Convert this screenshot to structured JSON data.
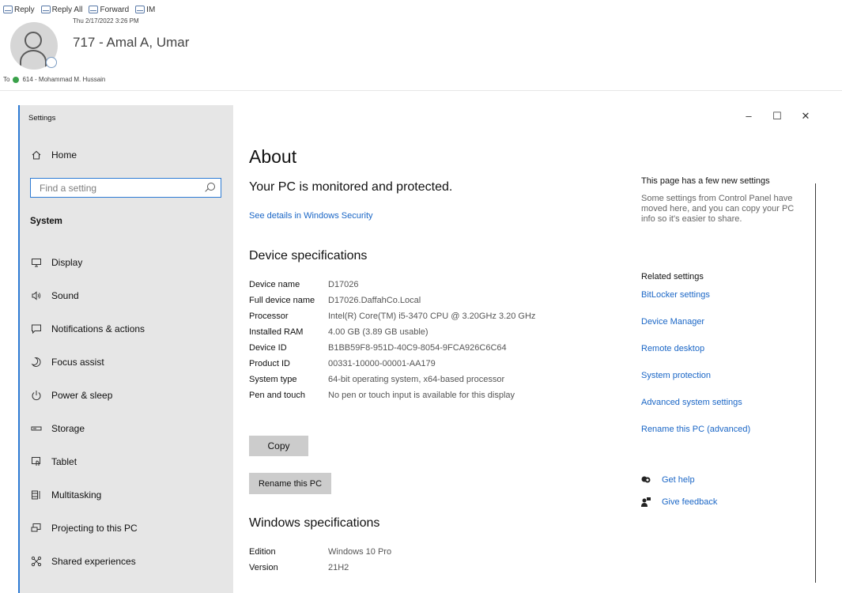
{
  "email": {
    "toolbar": {
      "reply": "Reply",
      "reply_all": "Reply All",
      "forward": "Forward",
      "im": "IM"
    },
    "date": "Thu 2/17/2022 3:26 PM",
    "sender": "717 - Amal A, Umar",
    "to_label": "To",
    "recipient": "614 - Mohammad M. Hussain"
  },
  "settings": {
    "app_title": "Settings",
    "home_label": "Home",
    "search_placeholder": "Find a setting",
    "section": "System",
    "nav": [
      {
        "label": "Display",
        "icon": "monitor-icon"
      },
      {
        "label": "Sound",
        "icon": "speaker-icon"
      },
      {
        "label": "Notifications & actions",
        "icon": "notification-icon"
      },
      {
        "label": "Focus assist",
        "icon": "moon-icon"
      },
      {
        "label": "Power & sleep",
        "icon": "power-icon"
      },
      {
        "label": "Storage",
        "icon": "storage-icon"
      },
      {
        "label": "Tablet",
        "icon": "tablet-icon"
      },
      {
        "label": "Multitasking",
        "icon": "multitasking-icon"
      },
      {
        "label": "Projecting to this PC",
        "icon": "projecting-icon"
      },
      {
        "label": "Shared experiences",
        "icon": "shared-icon"
      }
    ],
    "window_controls": {
      "minimize": "–",
      "maximize": "☐",
      "close": "✕"
    }
  },
  "about": {
    "title": "About",
    "protected": "Your PC is monitored and protected.",
    "security_link": "See details in Windows Security",
    "device_heading": "Device specifications",
    "device_specs": [
      {
        "key": "Device name",
        "value": "D17026"
      },
      {
        "key": "Full device name",
        "value": "D17026.DaffahCo.Local"
      },
      {
        "key": "Processor",
        "value": "Intel(R) Core(TM) i5-3470 CPU @ 3.20GHz   3.20 GHz"
      },
      {
        "key": "Installed RAM",
        "value": "4.00 GB (3.89 GB usable)"
      },
      {
        "key": "Device ID",
        "value": "B1BB59F8-951D-40C9-8054-9FCA926C6C64"
      },
      {
        "key": "Product ID",
        "value": "00331-10000-00001-AA179"
      },
      {
        "key": "System type",
        "value": "64-bit operating system, x64-based processor"
      },
      {
        "key": "Pen and touch",
        "value": "No pen or touch input is available for this display"
      }
    ],
    "copy_button": "Copy",
    "rename_button": "Rename this PC",
    "windows_heading": "Windows specifications",
    "windows_specs": [
      {
        "key": "Edition",
        "value": "Windows 10 Pro"
      },
      {
        "key": "Version",
        "value": "21H2"
      }
    ]
  },
  "right_panel": {
    "notice_title": "This page has a few new settings",
    "notice_body": "Some settings from Control Panel have moved here, and you can copy your PC info so it's easier to share.",
    "related_title": "Related settings",
    "related_links": [
      "BitLocker settings",
      "Device Manager",
      "Remote desktop",
      "System protection",
      "Advanced system settings",
      "Rename this PC (advanced)"
    ],
    "get_help": "Get help",
    "give_feedback": "Give feedback"
  }
}
